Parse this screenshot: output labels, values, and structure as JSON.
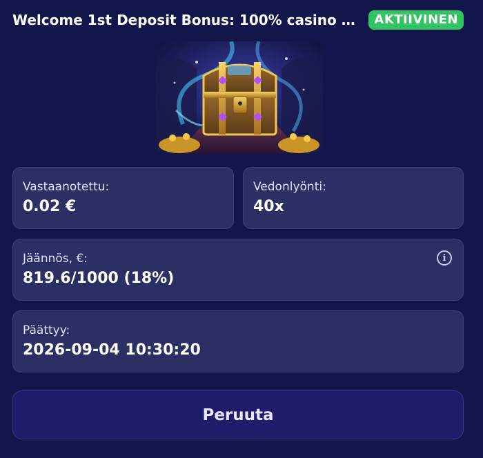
{
  "header": {
    "title": "Welcome 1st Deposit Bonus: 100% casino bo…",
    "status": "AKTIIVINEN"
  },
  "stats": {
    "received": {
      "label": "Vastaanotettu:",
      "value": "0.02 €"
    },
    "wagering": {
      "label": "Vedonlyönti:",
      "value": "40x"
    },
    "remaining": {
      "label": "Jäännös, €:",
      "value": "819.6/1000 (18%)"
    },
    "expires": {
      "label": "Päättyy:",
      "value": "2026-09-04 10:30:20"
    }
  },
  "actions": {
    "cancel_label": "Peruuta"
  },
  "icons": {
    "info": "info-icon"
  },
  "colors": {
    "background": "#12164a",
    "tile": "#2b2f63",
    "badge": "#32c463",
    "button": "#1e1d6a"
  }
}
